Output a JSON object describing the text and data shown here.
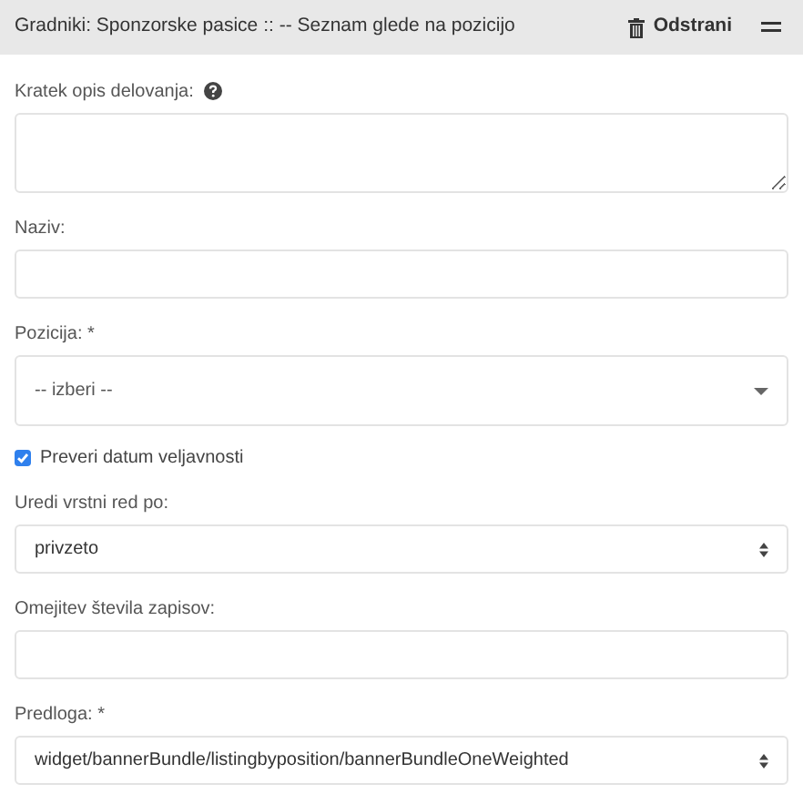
{
  "header": {
    "title": "Gradniki: Sponzorske pasice :: -- Seznam glede na pozicijo",
    "remove_button": "Odstrani"
  },
  "fields": [
    {
      "kind": "textarea",
      "label": "Kratek opis delovanja:",
      "help": true
    },
    {
      "kind": "text",
      "label": "Naziv:"
    },
    {
      "kind": "dropdown",
      "label": "Pozicija: *",
      "value": "-- izberi --"
    },
    {
      "kind": "checkbox",
      "label": "Preveri datum veljavnosti",
      "checked": true
    },
    {
      "kind": "select",
      "label": "Uredi vrstni red po:",
      "value": "privzeto"
    },
    {
      "kind": "text",
      "label": "Omejitev števila zapisov:"
    },
    {
      "kind": "select",
      "label": "Predloga: *",
      "value": "widget/bannerBundle/listingbyposition/bannerBundleOneWeighted"
    }
  ]
}
